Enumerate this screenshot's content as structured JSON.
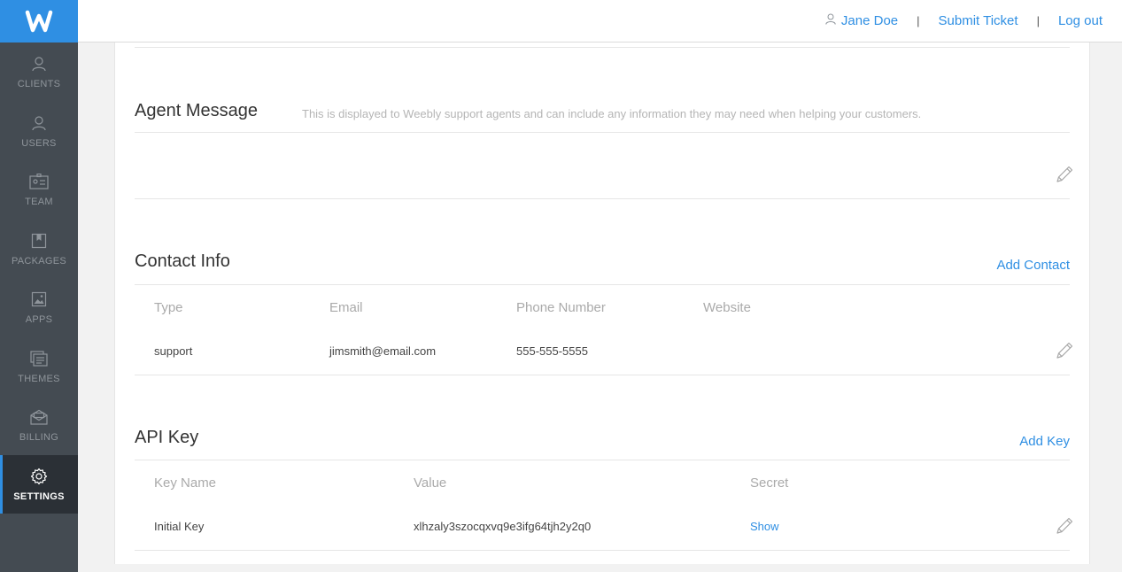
{
  "header": {
    "user_name": "Jane Doe",
    "submit_ticket": "Submit Ticket",
    "logout": "Log out",
    "separator": "|"
  },
  "sidebar": {
    "items": [
      {
        "label": "CLIENTS",
        "icon": "person-icon"
      },
      {
        "label": "USERS",
        "icon": "person-icon"
      },
      {
        "label": "TEAM",
        "icon": "team-card-icon"
      },
      {
        "label": "PACKAGES",
        "icon": "package-icon"
      },
      {
        "label": "APPS",
        "icon": "image-icon"
      },
      {
        "label": "THEMES",
        "icon": "themes-icon"
      },
      {
        "label": "BILLING",
        "icon": "billing-icon"
      },
      {
        "label": "SETTINGS",
        "icon": "gear-icon",
        "active": true
      }
    ]
  },
  "agent_message": {
    "title": "Agent Message",
    "description": "This is displayed to Weebly support agents and can include any information they may need when helping your customers."
  },
  "contact_info": {
    "title": "Contact Info",
    "action": "Add Contact",
    "columns": [
      "Type",
      "Email",
      "Phone Number",
      "Website"
    ],
    "rows": [
      {
        "type": "support",
        "email": "jimsmith@email.com",
        "phone": "555-555-5555",
        "website": ""
      }
    ]
  },
  "api_key": {
    "title": "API Key",
    "action": "Add Key",
    "columns": [
      "Key Name",
      "Value",
      "Secret"
    ],
    "rows": [
      {
        "name": "Initial Key",
        "value": "xlhzaly3szocqxvq9e3ifg64tjh2y2q0",
        "secret": "Show"
      }
    ]
  },
  "colors": {
    "accent": "#2f8fe3",
    "sidebar": "#444b52",
    "sidebar_active": "#2b3036"
  }
}
